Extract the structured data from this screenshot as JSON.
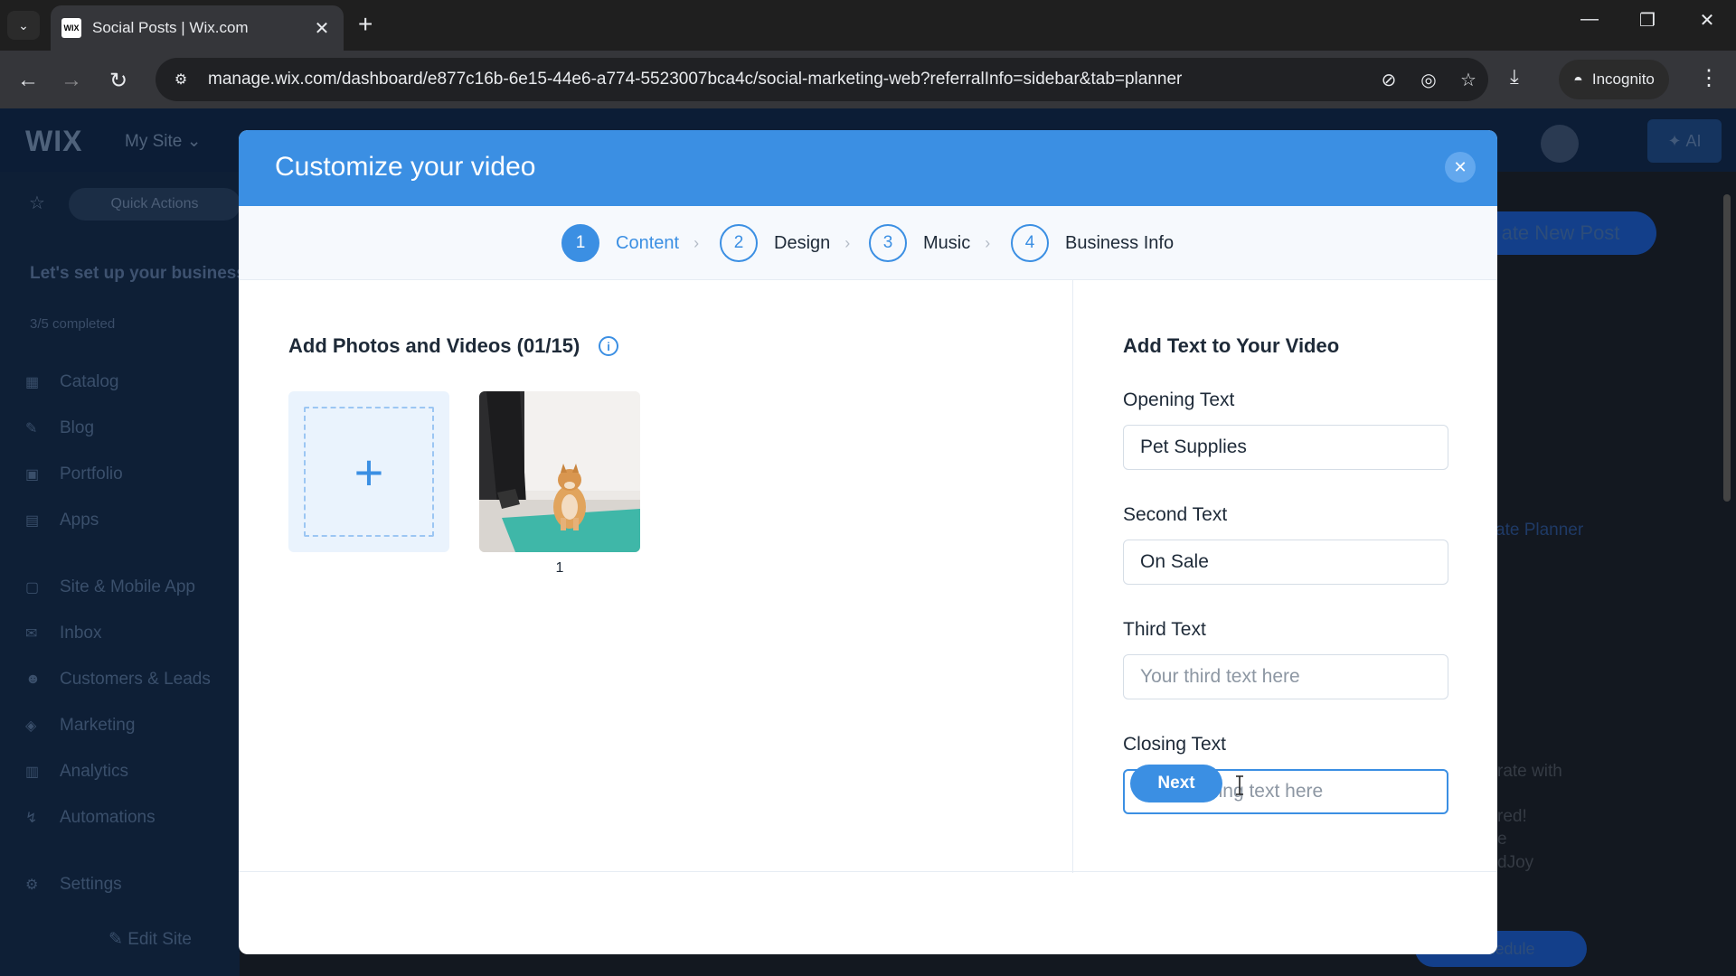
{
  "browser": {
    "tab_title": "Social Posts | Wix.com",
    "favicon_text": "WIX",
    "url": "manage.wix.com/dashboard/e877c16b-6e15-44e6-a774-5523007bca4c/social-marketing-web?referralInfo=sidebar&tab=planner",
    "incognito_label": "Incognito"
  },
  "dashboard": {
    "logo": "WIX",
    "site_name": "My Site",
    "ai_label": "AI",
    "quick_actions": "Quick Actions",
    "setup_title": "Let's set up your business",
    "completed": "3/5 completed",
    "sidebar_items": [
      {
        "label": "Catalog",
        "icon": "catalog-icon"
      },
      {
        "label": "Blog",
        "icon": "blog-icon"
      },
      {
        "label": "Portfolio",
        "icon": "portfolio-icon"
      },
      {
        "label": "Apps",
        "icon": "apps-icon"
      },
      {
        "label": "Site & Mobile App",
        "icon": "site-icon"
      },
      {
        "label": "Inbox",
        "icon": "inbox-icon"
      },
      {
        "label": "Customers & Leads",
        "icon": "customers-icon"
      },
      {
        "label": "Marketing",
        "icon": "marketing-icon"
      },
      {
        "label": "Analytics",
        "icon": "analytics-icon"
      },
      {
        "label": "Automations",
        "icon": "automations-icon"
      },
      {
        "label": "Settings",
        "icon": "settings-icon"
      }
    ],
    "edit_site": "Edit Site",
    "create_post": "ate New Post",
    "planner_text": "ate Planner",
    "bg_text_1": "rate with",
    "bg_text_2": "red!",
    "bg_text_3": "e",
    "bg_text_4": "dJoy",
    "schedule": "Schedule"
  },
  "modal": {
    "title": "Customize your video",
    "steps": [
      {
        "num": "1",
        "label": "Content"
      },
      {
        "num": "2",
        "label": "Design"
      },
      {
        "num": "3",
        "label": "Music"
      },
      {
        "num": "4",
        "label": "Business Info"
      }
    ],
    "media_section_title": "Add Photos and Videos (01/15)",
    "media_items": [
      {
        "index": "1"
      }
    ],
    "text_section_title": "Add Text to Your Video",
    "fields": {
      "opening": {
        "label": "Opening Text",
        "value": "Pet Supplies",
        "placeholder": ""
      },
      "second": {
        "label": "Second Text",
        "value": "On Sale",
        "placeholder": ""
      },
      "third": {
        "label": "Third Text",
        "value": "",
        "placeholder": "Your third text here"
      },
      "closing": {
        "label": "Closing Text",
        "value": "",
        "placeholder": "Your closing text here"
      }
    },
    "next_label": "Next"
  },
  "colors": {
    "accent": "#3b8fe3",
    "header": "#3b8fe3",
    "text": "#1e2a38"
  }
}
